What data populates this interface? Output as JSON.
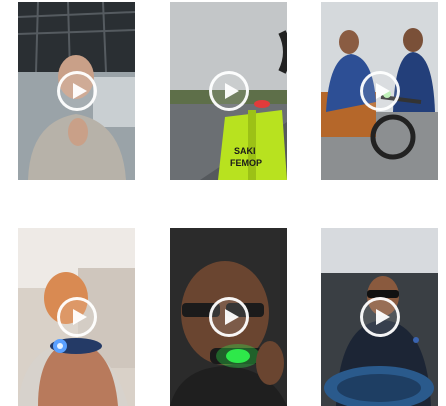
{
  "gallery": {
    "videos": [
      {
        "id": "v1",
        "sign_text": ""
      },
      {
        "id": "v2",
        "sign_text": "SAKI\nFEMOP"
      },
      {
        "id": "v3",
        "sign_text": ""
      },
      {
        "id": "v4",
        "sign_text": ""
      },
      {
        "id": "v5",
        "sign_text": ""
      },
      {
        "id": "v6",
        "sign_text": ""
      }
    ],
    "play_icon": "play-circle-icon",
    "colors": {
      "background": "#ffffff",
      "vest": "#b8e21f",
      "green_light": "#2fe84a",
      "blue_light": "#5aa0ff"
    }
  }
}
